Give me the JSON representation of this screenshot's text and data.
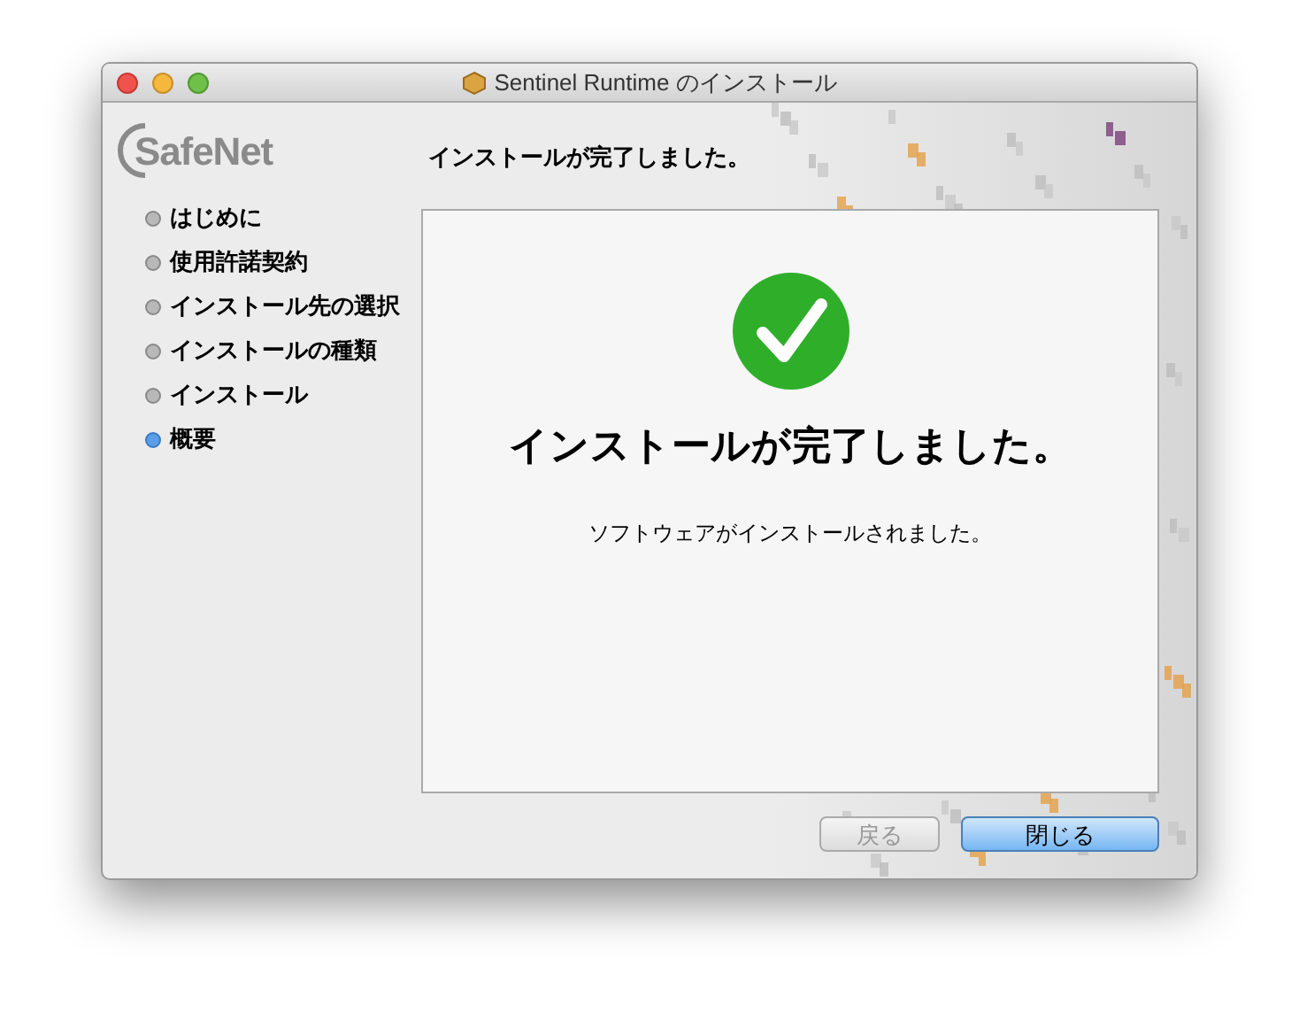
{
  "window": {
    "title": "Sentinel Runtime のインストール"
  },
  "logo": {
    "text": "SafeNet"
  },
  "heading": "インストールが完了しました。",
  "steps": [
    {
      "label": "はじめに",
      "selected": false
    },
    {
      "label": "使用許諾契約",
      "selected": false
    },
    {
      "label": "インストール先の選択",
      "selected": false
    },
    {
      "label": "インストールの種類",
      "selected": false
    },
    {
      "label": "インストール",
      "selected": false
    },
    {
      "label": "概要",
      "selected": true
    }
  ],
  "panel": {
    "title": "インストールが完了しました。",
    "message": "ソフトウェアがインストールされました。"
  },
  "buttons": [
    {
      "label": "戻る",
      "disabled": true,
      "default": false
    },
    {
      "label": "閉じる",
      "disabled": false,
      "default": true
    }
  ]
}
